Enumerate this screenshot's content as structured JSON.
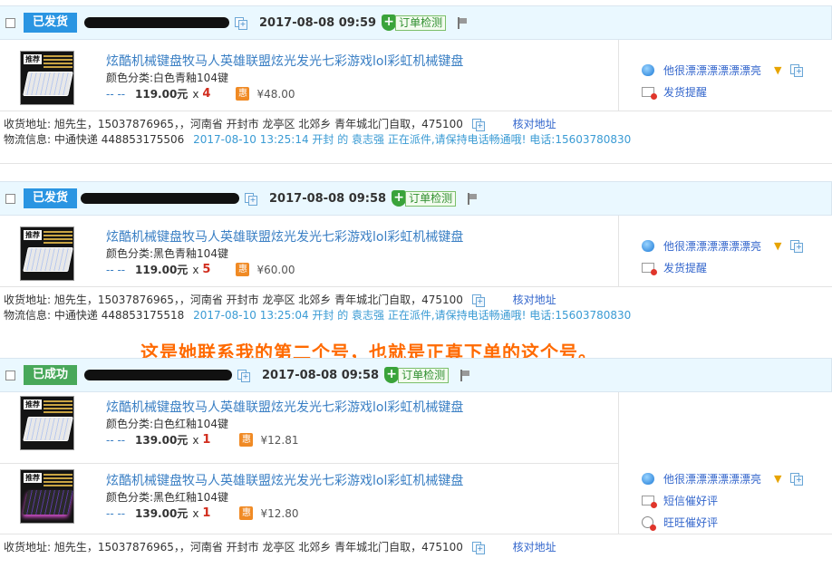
{
  "orders": [
    {
      "status": "已发货",
      "date": "2017-08-08 09:59",
      "detect_label": "订单检测",
      "items": [
        {
          "title": "炫酷机械键盘牧马人英雄联盟炫光发光七彩游戏lol彩虹机械键盘",
          "variant": "颜色分类:白色青釉104键",
          "dash": "-- --",
          "price": "119.00元",
          "x": "x",
          "qty": "4",
          "hui": "惠",
          "discount": "¥48.00"
        }
      ],
      "actions": [
        "他很漂漂漂漂漂漂亮",
        "发货提醒"
      ],
      "address_label": "收货地址:",
      "address": "旭先生，15037876965，，河南省 开封市 龙亭区 北郊乡 青年城北门自取，475100",
      "verify": "核对地址",
      "logistics_label": "物流信息:",
      "carrier": "中通快递  448853175506",
      "tracking": "2017-08-10 13:25:14 开封 的 袁志强 正在派件,请保持电话畅通哦! 电话:15603780830"
    },
    {
      "status": "已发货",
      "date": "2017-08-08 09:58",
      "detect_label": "订单检测",
      "items": [
        {
          "title": "炫酷机械键盘牧马人英雄联盟炫光发光七彩游戏lol彩虹机械键盘",
          "variant": "颜色分类:黑色青釉104键",
          "dash": "-- --",
          "price": "119.00元",
          "x": "x",
          "qty": "5",
          "hui": "惠",
          "discount": "¥60.00"
        }
      ],
      "actions": [
        "他很漂漂漂漂漂漂亮",
        "发货提醒"
      ],
      "address_label": "收货地址:",
      "address": "旭先生，15037876965，，河南省 开封市 龙亭区 北郊乡 青年城北门自取，475100",
      "verify": "核对地址",
      "logistics_label": "物流信息:",
      "carrier": "中通快递  448853175518",
      "tracking": "2017-08-10 13:25:04 开封 的 袁志强 正在派件,请保持电话畅通哦! 电话:15603780830"
    },
    {
      "status": "已成功",
      "date": "2017-08-08 09:58",
      "detect_label": "订单检测",
      "items": [
        {
          "title": "炫酷机械键盘牧马人英雄联盟炫光发光七彩游戏lol彩虹机械键盘",
          "variant": "颜色分类:白色红釉104键",
          "dash": "-- --",
          "price": "139.00元",
          "x": "x",
          "qty": "1",
          "hui": "惠",
          "discount": "¥12.81"
        },
        {
          "title": "炫酷机械键盘牧马人英雄联盟炫光发光七彩游戏lol彩虹机械键盘",
          "variant": "颜色分类:黑色红釉104键",
          "dash": "-- --",
          "price": "139.00元",
          "x": "x",
          "qty": "1",
          "hui": "惠",
          "discount": "¥12.80"
        }
      ],
      "actions": [
        "他很漂漂漂漂漂漂亮",
        "短信催好评",
        "旺旺催好评"
      ],
      "address_label": "收货地址:",
      "address": "旭先生，15037876965，，河南省 开封市 龙亭区 北郊乡 青年城北门自取，475100",
      "verify": "核对地址"
    }
  ],
  "annotation": "这是她联系我的第二个号，也就是正真下单的这个号。",
  "colors": {
    "accent": "#3a7fc4",
    "shipped": "#2a95e2",
    "success": "#48a85a",
    "qty": "#d12d1e",
    "annotation": "#ff6a00"
  }
}
